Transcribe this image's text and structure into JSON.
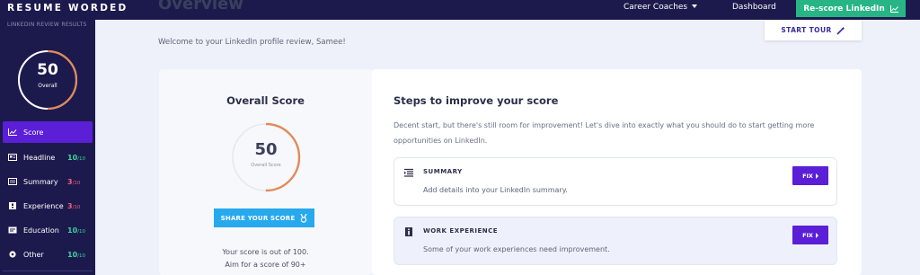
{
  "header": {
    "logo": "RESUME WORDED",
    "nav": {
      "career_coaches": "Career Coaches",
      "dashboard": "Dashboard"
    },
    "rescore_button": "Re-score LinkedIn",
    "rescore_icon": "chart-icon"
  },
  "sidebar": {
    "caption": "LINKEDIN REVIEW RESULTS",
    "score": {
      "value": "50",
      "label": "Overall",
      "fraction": 0.5
    },
    "items": [
      {
        "label": "Score",
        "icon": "chart-icon",
        "active": true
      },
      {
        "label": "Headline",
        "icon": "card-icon",
        "score": "10",
        "max": "/10",
        "status": "good"
      },
      {
        "label": "Summary",
        "icon": "list-icon",
        "score": "3",
        "max": "/10",
        "status": "bad"
      },
      {
        "label": "Experience",
        "icon": "briefcase-icon",
        "score": "3",
        "max": "/10",
        "status": "bad"
      },
      {
        "label": "Education",
        "icon": "graduation-icon",
        "score": "10",
        "max": "/10",
        "status": "good"
      },
      {
        "label": "Other",
        "icon": "circle-icon",
        "score": "10",
        "max": "/10",
        "status": "good"
      }
    ]
  },
  "main": {
    "title": "Overview",
    "welcome": "Welcome to your LinkedIn profile review, Samee!",
    "start_tour": "START TOUR",
    "start_tour_icon": "magic-wand-icon"
  },
  "score_card": {
    "title": "Overall Score",
    "value": "50",
    "label": "Overall Score",
    "fraction": 0.5,
    "share_button": "SHARE YOUR SCORE",
    "share_icon": "medal-icon",
    "note_line1": "Your score is out of 100.",
    "note_line2": "Aim for a score of 90+"
  },
  "steps": {
    "title": "Steps to improve your score",
    "description": "Decent start, but there's still room for improvement! Let's dive into exactly what you should do to start getting more opportunities on LinkedIn.",
    "items": [
      {
        "title": "SUMMARY",
        "description": "Add details into your LinkedIn summary.",
        "fix_label": "FIX",
        "icon": "list-icon"
      },
      {
        "title": "WORK EXPERIENCE",
        "description": "Some of your work experiences need improvement.",
        "fix_label": "FIX",
        "icon": "info-icon"
      }
    ]
  },
  "colors": {
    "navy": "#1c1a4d",
    "purple": "#5a1fd6",
    "green": "#27b585",
    "ring_orange": "#e28a5a",
    "share_blue": "#27a9ee",
    "score_green": "#3fd29b",
    "score_red": "#f0617a"
  }
}
